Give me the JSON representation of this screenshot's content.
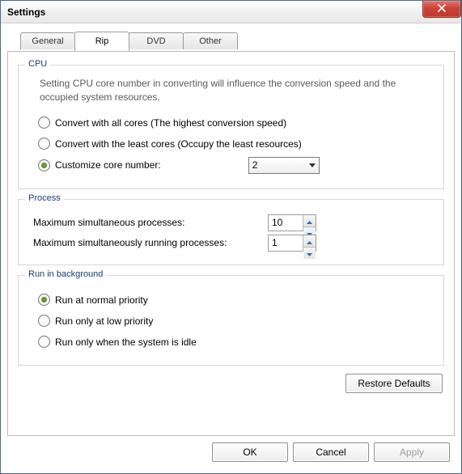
{
  "window": {
    "title": "Settings"
  },
  "tabs": {
    "general": "General",
    "rip": "Rip",
    "dvd": "DVD",
    "other": "Other"
  },
  "cpu": {
    "legend": "CPU",
    "description": "Setting CPU core number in converting will influence the conversion speed and the occupied system resources.",
    "opt_all": "Convert with all cores (The highest conversion speed)",
    "opt_least": "Convert with the least cores (Occupy the least resources)",
    "opt_custom": "Customize core number:",
    "core_value": "2"
  },
  "process": {
    "legend": "Process",
    "max_simultaneous_label": "Maximum simultaneous processes:",
    "max_simultaneous_value": "10",
    "max_running_label": "Maximum simultaneously running processes:",
    "max_running_value": "1"
  },
  "background": {
    "legend": "Run in background",
    "opt_normal": "Run at normal priority",
    "opt_low": "Run only at low priority",
    "opt_idle": "Run only when the system is idle"
  },
  "buttons": {
    "restore": "Restore Defaults",
    "ok": "OK",
    "cancel": "Cancel",
    "apply": "Apply"
  }
}
